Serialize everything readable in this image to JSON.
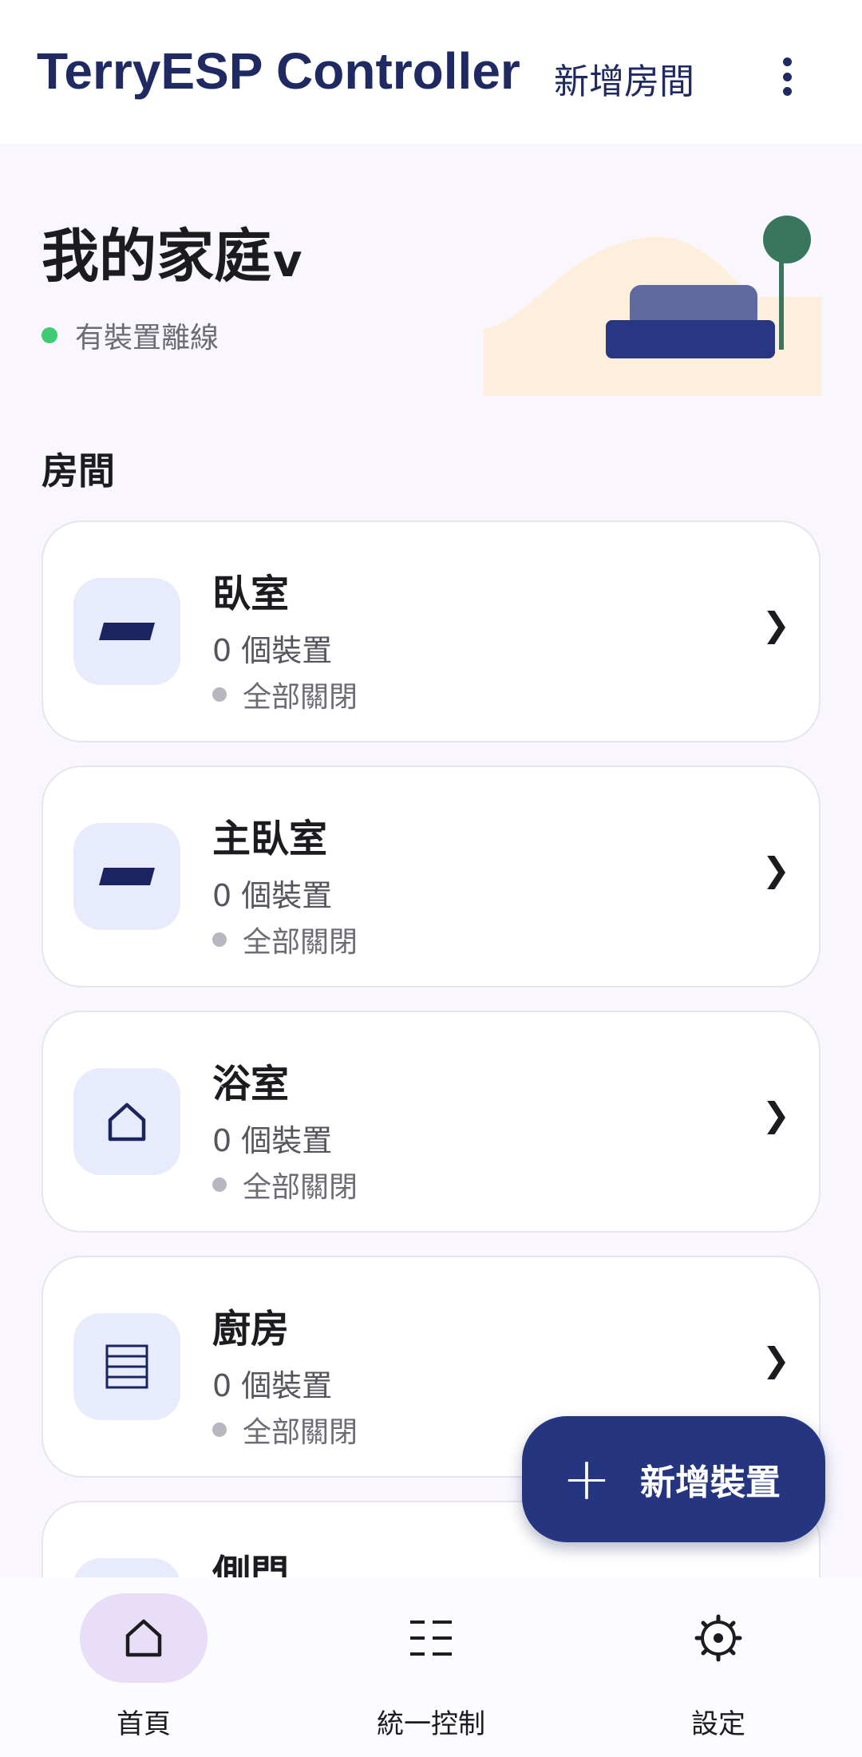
{
  "header": {
    "title": "TerryESP Controller",
    "add_room_label": "新增房間",
    "menu_icon": "more-vert-icon"
  },
  "home": {
    "title": "我的家庭",
    "caret": "v",
    "status_text": "有裝置離線",
    "status_color": "#3ecb74"
  },
  "rooms_section": {
    "title": "房間",
    "rooms": [
      {
        "name": "臥室",
        "device_count": "0 個裝置",
        "state": "全部關閉",
        "icon": "bed-icon"
      },
      {
        "name": "主臥室",
        "device_count": "0 個裝置",
        "state": "全部關閉",
        "icon": "bed-icon"
      },
      {
        "name": "浴室",
        "device_count": "0 個裝置",
        "state": "全部關閉",
        "icon": "house-icon"
      },
      {
        "name": "廚房",
        "device_count": "0 個裝置",
        "state": "全部關閉",
        "icon": "kitchen-icon"
      },
      {
        "name": "側門",
        "device_count": "",
        "state": "",
        "icon": ""
      }
    ]
  },
  "fab": {
    "plus": "+",
    "label": "新增裝置"
  },
  "bottom_nav": {
    "items": [
      {
        "label": "首頁",
        "icon": "home-icon",
        "active": true
      },
      {
        "label": "統一控制",
        "icon": "list-icon",
        "active": false
      },
      {
        "label": "設定",
        "icon": "settings-icon",
        "active": false
      }
    ]
  },
  "colors": {
    "primary": "#1f2a63",
    "fab": "#253580",
    "active_nav": "#e8def8",
    "icon_bg": "#e8ebfb",
    "background": "#f9f7fd"
  }
}
